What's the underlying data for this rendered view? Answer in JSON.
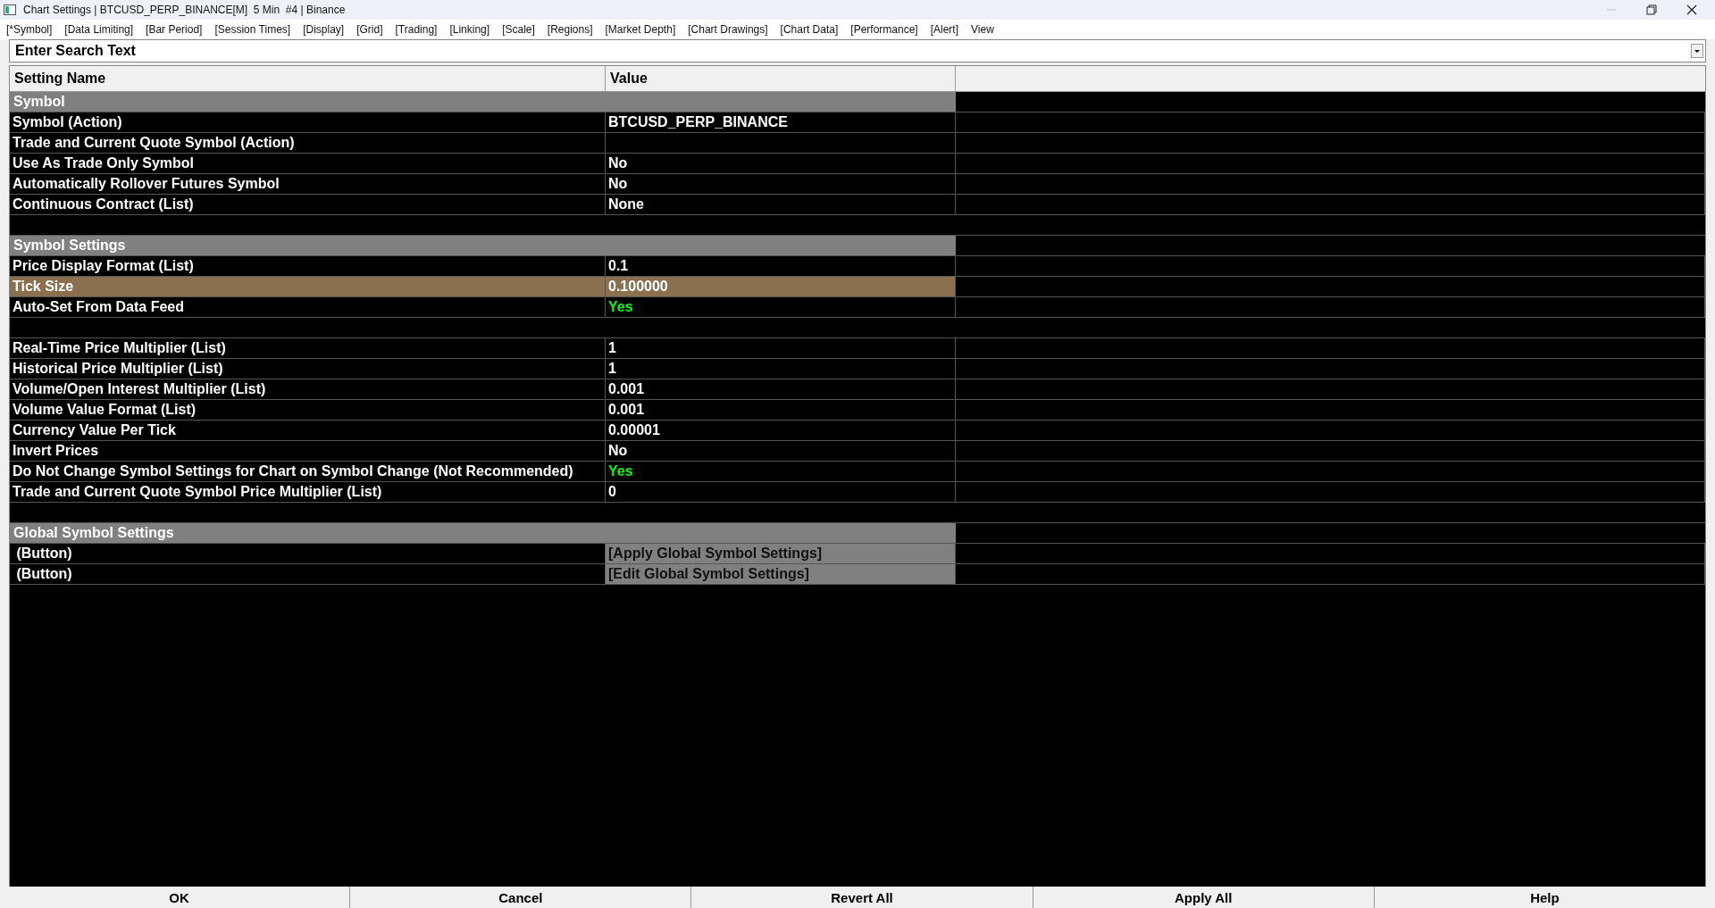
{
  "window": {
    "title": "Chart Settings | BTCUSD_PERP_BINANCE[M]  5 Min  #4 | Binance"
  },
  "menu": [
    "[*Symbol]",
    "[Data Limiting]",
    "[Bar Period]",
    "[Session Times]",
    "[Display]",
    "[Grid]",
    "[Trading]",
    "[Linking]",
    "[Scale]",
    "[Regions]",
    "[Market Depth]",
    "[Chart Drawings]",
    "[Chart Data]",
    "[Performance]",
    "[Alert]",
    "View"
  ],
  "search": {
    "placeholder": "Enter Search Text"
  },
  "table": {
    "columns": [
      "Setting Name",
      "Value"
    ],
    "rows": [
      {
        "kind": "section",
        "name": "Symbol"
      },
      {
        "kind": "setting",
        "name": "Symbol (Action)",
        "value": "BTCUSD_PERP_BINANCE",
        "highlighted": false,
        "selected": false
      },
      {
        "kind": "setting",
        "name": "Trade and Current Quote Symbol (Action)",
        "selected": false
      },
      {
        "kind": "setting",
        "name": "Use As Trade Only Symbol",
        "value": "No",
        "highlighted": false,
        "selected": false
      },
      {
        "kind": "setting",
        "name": "Automatically Rollover Futures Symbol",
        "value": "No",
        "highlighted": false,
        "selected": false
      },
      {
        "kind": "setting",
        "name": "Continuous Contract (List)",
        "value": "None",
        "highlighted": false,
        "selected": false
      },
      {
        "kind": "blank"
      },
      {
        "kind": "section",
        "name": "Symbol Settings"
      },
      {
        "kind": "setting",
        "name": "Price Display Format (List)",
        "value": "0.1",
        "highlighted": false,
        "selected": false
      },
      {
        "kind": "setting",
        "name": "Tick Size",
        "value": "0.100000",
        "highlighted": false,
        "selected": true
      },
      {
        "kind": "setting",
        "name": "Auto-Set From Data Feed",
        "value": "Yes",
        "highlighted": true,
        "selected": false
      },
      {
        "kind": "blank"
      },
      {
        "kind": "setting",
        "name": "Real-Time Price Multiplier (List)",
        "value": "1",
        "highlighted": false,
        "selected": false
      },
      {
        "kind": "setting",
        "name": "Historical Price Multiplier (List)",
        "value": "1",
        "highlighted": false,
        "selected": false
      },
      {
        "kind": "setting",
        "name": "Volume/Open Interest Multiplier (List)",
        "value": "0.001",
        "highlighted": false,
        "selected": false
      },
      {
        "kind": "setting",
        "name": "Volume Value Format (List)",
        "value": "0.001",
        "highlighted": false,
        "selected": false
      },
      {
        "kind": "setting",
        "name": "Currency Value Per Tick",
        "value": "0.00001",
        "highlighted": false,
        "selected": false
      },
      {
        "kind": "setting",
        "name": "Invert Prices",
        "value": "No",
        "highlighted": false,
        "selected": false
      },
      {
        "kind": "setting",
        "name": "Do Not Change Symbol Settings for Chart on Symbol Change (Not Recommended)",
        "value": "Yes",
        "highlighted": true,
        "selected": false
      },
      {
        "kind": "setting",
        "name": "Trade and Current Quote Symbol Price Multiplier (List)",
        "value": "0",
        "highlighted": false,
        "selected": false
      },
      {
        "kind": "blank"
      },
      {
        "kind": "section",
        "name": "Global Symbol Settings"
      },
      {
        "kind": "button",
        "name": " (Button)",
        "value": "[Apply Global Symbol Settings]"
      },
      {
        "kind": "button",
        "name": " (Button)",
        "value": "[Edit Global Symbol Settings]"
      }
    ]
  },
  "buttons": [
    "OK",
    "Cancel",
    "Revert All",
    "Apply All",
    "Help"
  ]
}
